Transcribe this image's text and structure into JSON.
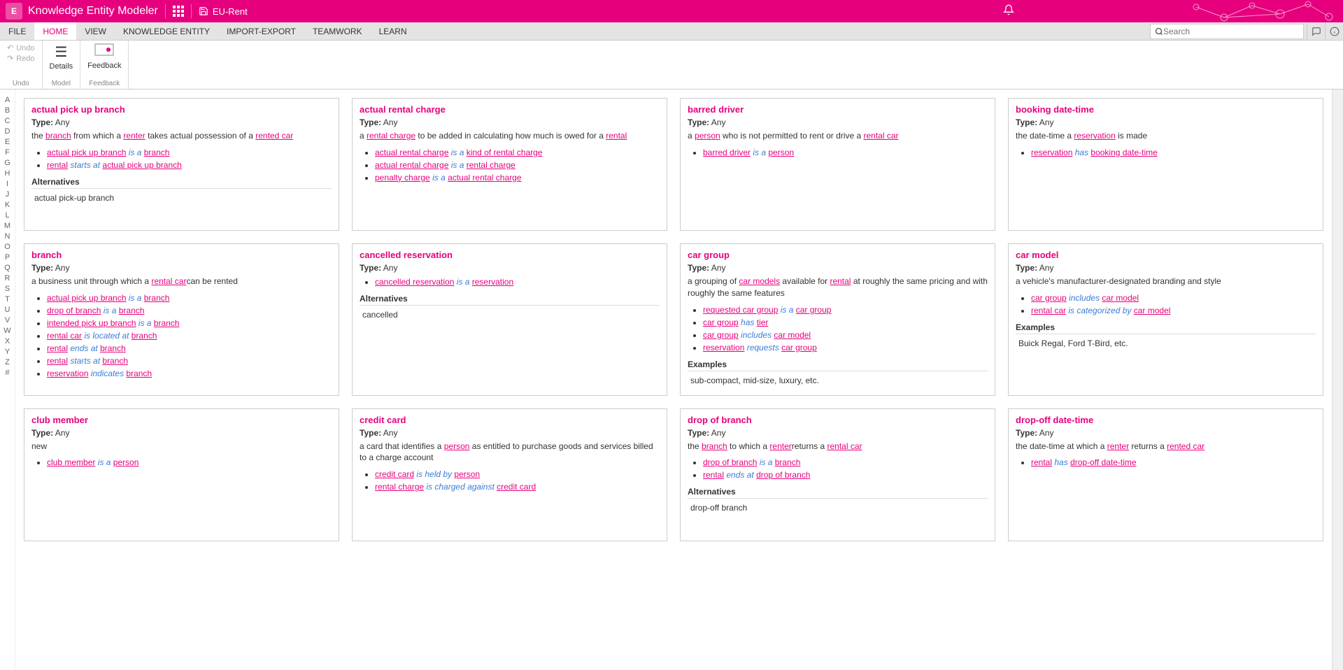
{
  "header": {
    "app_title": "Knowledge Entity Modeler",
    "project_name": "EU-Rent",
    "logo_letter": "E"
  },
  "menu": {
    "items": [
      "FILE",
      "HOME",
      "VIEW",
      "KNOWLEDGE ENTITY",
      "IMPORT-EXPORT",
      "TEAMWORK",
      "LEARN"
    ],
    "active": 1,
    "search_placeholder": "Search"
  },
  "ribbon": {
    "undo": "Undo",
    "redo": "Redo",
    "group_undo": "Undo",
    "details": "Details",
    "group_model": "Model",
    "feedback": "Feedback",
    "group_feedback": "Feedback"
  },
  "alpha": [
    "A",
    "B",
    "C",
    "D",
    "E",
    "F",
    "G",
    "H",
    "I",
    "J",
    "K",
    "L",
    "M",
    "N",
    "O",
    "P",
    "Q",
    "R",
    "S",
    "T",
    "U",
    "V",
    "W",
    "X",
    "Y",
    "Z",
    "#"
  ],
  "cards": [
    {
      "title": "actual pick up branch",
      "type": "Any",
      "desc": [
        {
          "t": "the "
        },
        {
          "l": "branch"
        },
        {
          "t": " from which a "
        },
        {
          "l": "renter"
        },
        {
          "t": " takes actual possession of a "
        },
        {
          "l": "rented car"
        }
      ],
      "rels": [
        [
          {
            "l": "actual pick up branch"
          },
          {
            "p": " is a "
          },
          {
            "l": "branch"
          }
        ],
        [
          {
            "l": "rental"
          },
          {
            "p": " starts at "
          },
          {
            "l": "actual pick up branch"
          }
        ]
      ],
      "alt_header": "Alternatives",
      "alt_body": "actual pick-up branch"
    },
    {
      "title": "actual rental charge",
      "type": "Any",
      "desc": [
        {
          "t": "a "
        },
        {
          "l": "rental charge"
        },
        {
          "t": " to be added in calculating how much is owed for a "
        },
        {
          "l": "rental"
        }
      ],
      "rels": [
        [
          {
            "l": "actual rental charge"
          },
          {
            "p": " is a "
          },
          {
            "l": "kind of rental charge"
          }
        ],
        [
          {
            "l": "actual rental charge"
          },
          {
            "p": " is a "
          },
          {
            "l": "rental charge"
          }
        ],
        [
          {
            "l": "penalty charge"
          },
          {
            "p": " is a "
          },
          {
            "l": "actual rental charge"
          }
        ]
      ]
    },
    {
      "title": "barred driver",
      "type": "Any",
      "desc": [
        {
          "t": "a "
        },
        {
          "l": "person"
        },
        {
          "t": " who is not permitted to rent or drive a "
        },
        {
          "l": "rental car"
        }
      ],
      "rels": [
        [
          {
            "l": "barred driver"
          },
          {
            "p": " is a "
          },
          {
            "l": "person"
          }
        ]
      ]
    },
    {
      "title": "booking date-time",
      "type": "Any",
      "desc": [
        {
          "t": "the date-time a "
        },
        {
          "l": "reservation"
        },
        {
          "t": " is made"
        }
      ],
      "rels": [
        [
          {
            "l": "reservation"
          },
          {
            "p": " has "
          },
          {
            "l": "booking date-time"
          }
        ]
      ]
    },
    {
      "title": "branch",
      "type": "Any",
      "desc": [
        {
          "t": "a business unit through which a "
        },
        {
          "l": "rental car"
        },
        {
          "t": "can be rented"
        }
      ],
      "rels": [
        [
          {
            "l": "actual pick up branch"
          },
          {
            "p": " is a "
          },
          {
            "l": "branch"
          }
        ],
        [
          {
            "l": "drop of branch"
          },
          {
            "p": " is a "
          },
          {
            "l": "branch"
          }
        ],
        [
          {
            "l": "intended pick up branch"
          },
          {
            "p": " is a "
          },
          {
            "l": "branch"
          }
        ],
        [
          {
            "l": "rental car"
          },
          {
            "p": " is located at "
          },
          {
            "l": "branch"
          }
        ],
        [
          {
            "l": "rental"
          },
          {
            "p": " ends at "
          },
          {
            "l": "branch"
          }
        ],
        [
          {
            "l": "rental"
          },
          {
            "p": " starts at "
          },
          {
            "l": "branch"
          }
        ],
        [
          {
            "l": "reservation"
          },
          {
            "p": " indicates "
          },
          {
            "l": "branch"
          }
        ]
      ]
    },
    {
      "title": "cancelled reservation",
      "type": "Any",
      "rels": [
        [
          {
            "l": "cancelled reservation"
          },
          {
            "p": " is a "
          },
          {
            "l": "reservation"
          }
        ]
      ],
      "alt_header": "Alternatives",
      "alt_body": "cancelled"
    },
    {
      "title": "car group",
      "type": "Any",
      "desc": [
        {
          "t": "a grouping of "
        },
        {
          "l": "car models"
        },
        {
          "t": " available for "
        },
        {
          "l": "rental"
        },
        {
          "t": " at roughly the same pricing and with roughly the same features"
        }
      ],
      "rels": [
        [
          {
            "l": "requested car group"
          },
          {
            "p": " is a "
          },
          {
            "l": "car group"
          }
        ],
        [
          {
            "l": "car group"
          },
          {
            "p": " has "
          },
          {
            "l": "tier"
          }
        ],
        [
          {
            "l": "car group"
          },
          {
            "p": " includes "
          },
          {
            "l": "car model"
          }
        ],
        [
          {
            "l": "reservation"
          },
          {
            "p": " requests "
          },
          {
            "l": "car group"
          }
        ]
      ],
      "ex_header": "Examples",
      "ex_body": "sub-compact, mid-size, luxury, etc."
    },
    {
      "title": "car model",
      "type": "Any",
      "desc": [
        {
          "t": "a vehicle's manufacturer-designated branding and style"
        }
      ],
      "rels": [
        [
          {
            "l": "car group"
          },
          {
            "p": " includes "
          },
          {
            "l": "car model"
          }
        ],
        [
          {
            "l": "rental car"
          },
          {
            "p": " is categorized by "
          },
          {
            "l": "car model"
          }
        ]
      ],
      "ex_header": "Examples",
      "ex_body": "Buick Regal, Ford T-Bird, etc."
    },
    {
      "title": "club member",
      "type": "Any",
      "desc": [
        {
          "t": "new"
        }
      ],
      "rels": [
        [
          {
            "l": "club member"
          },
          {
            "p": " is a "
          },
          {
            "l": "person"
          }
        ]
      ]
    },
    {
      "title": "credit card",
      "type": "Any",
      "desc": [
        {
          "t": "a card that identifies a "
        },
        {
          "l": "person"
        },
        {
          "t": " as entitled to purchase goods and services billed to a charge account"
        }
      ],
      "rels": [
        [
          {
            "l": "credit card"
          },
          {
            "p": " is held by "
          },
          {
            "l": "person"
          }
        ],
        [
          {
            "l": "rental charge"
          },
          {
            "p": " is charged against "
          },
          {
            "l": "credit card"
          }
        ]
      ]
    },
    {
      "title": "drop of branch",
      "type": "Any",
      "desc": [
        {
          "t": "the "
        },
        {
          "l": "branch"
        },
        {
          "t": " to which a "
        },
        {
          "l": "renter"
        },
        {
          "t": "returns a "
        },
        {
          "l": "rental car"
        }
      ],
      "rels": [
        [
          {
            "l": "drop of branch"
          },
          {
            "p": " is a "
          },
          {
            "l": "branch"
          }
        ],
        [
          {
            "l": "rental"
          },
          {
            "p": " ends at "
          },
          {
            "l": "drop of branch"
          }
        ]
      ],
      "alt_header": "Alternatives",
      "alt_body": "drop-off branch"
    },
    {
      "title": "drop-off date-time",
      "type": "Any",
      "desc": [
        {
          "t": "the date-time at which a "
        },
        {
          "l": "renter"
        },
        {
          "t": " returns a "
        },
        {
          "l": "rented car"
        }
      ],
      "rels": [
        [
          {
            "l": "rental"
          },
          {
            "p": " has "
          },
          {
            "l": "drop-off date-time"
          }
        ]
      ]
    }
  ],
  "labels": {
    "type": "Type:"
  }
}
